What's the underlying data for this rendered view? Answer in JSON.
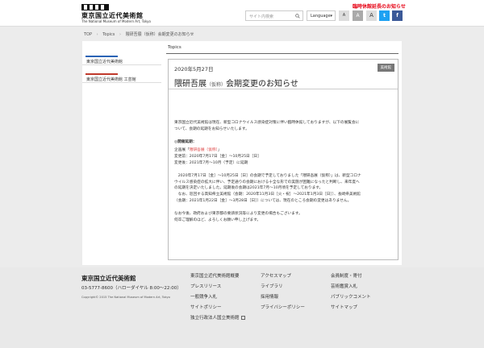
{
  "header": {
    "logo_jp": "東京国立近代美術館",
    "logo_en": "The National Museum of Modern Art, Tokyo",
    "search_placeholder": "サイト内検索",
    "language_label": "Language",
    "notice": "臨時休館延長のお知らせ",
    "font_small": "A",
    "font_mid": "A",
    "font_large": "A",
    "twitter": "t",
    "facebook": "f"
  },
  "breadcrumb": {
    "items": [
      "TOP",
      "Topics",
      "隈研吾展（仮称）会期変更のお知らせ"
    ]
  },
  "sidebar": {
    "items": [
      {
        "label": "東京国立近代美術館",
        "color": "#2a63b5"
      },
      {
        "label": "東京国立近代美術館 工芸館",
        "color": "#c0392b"
      }
    ]
  },
  "content": {
    "tab": "Topics",
    "date": "2020年5月27日",
    "category": "美術館",
    "title_main": "隈研吾展",
    "title_small": "（仮称）",
    "title_rest": "会期変更のお知らせ",
    "intro_1": "東京国立近代美術館は現在、新型コロナウイルス感染症対策に伴い臨時休館しておりますが、以下の展覧会に",
    "intro_2": "ついて、会期の延期をお知らせいたします。",
    "heading": "◎開催延期：",
    "plan_prefix": "企画展「",
    "plan_link": "隈研吾展（仮称）",
    "plan_suffix": "」",
    "before": "変更前：2020年7月17日［金］〜10月25日［日］",
    "after": "変更後：2021年7月〜10月（予定）に延期",
    "para_1": "　2020年7月17日［金］〜10月25日［日］の会期で予定しておりました「隈研吾展（仮称）」は、新型コロナ",
    "para_2": "ウイルス感染症の拡大に伴い、予定通りの会期における十全な形での実施が困難になったと判断し、来年度へ",
    "para_3": "の延期を決定いたしました。延期後の会期は2021年7月〜10月頃を予定しております。",
    "para_4": "　なお、巡回する高知県立美術館（会期：2020年11月3日［火・祝］〜2021年1月3日［日］）、長崎県美術館",
    "para_5": "（会期：2021年1月22日［金］〜3月28日［日］）については、現在のところ会期の変更はありません。",
    "closing_1": "なお今後、政府および東京都の要請状況等により変更の場合もございます。",
    "closing_2": "何卒ご理解のほど、よろしくお願い申し上げます。"
  },
  "footer": {
    "name": "東京国立近代美術館",
    "tel": "03-5777-8600（ハローダイヤル 8:00〜22:00）",
    "copyright": "Copyright© 2015 The National Museum of Modern Art, Tokyo",
    "col1": [
      "東京国立近代美術館概要",
      "プレスリリース",
      "一般競争入札",
      "サイトポリシー",
      "独立行政法人国立美術館"
    ],
    "col2": [
      "アクセスマップ",
      "ライブラリ",
      "採用情報",
      "プライバシーポリシー"
    ],
    "col3": [
      "会員制度・寄付",
      "芸術鑑賞入札",
      "パブリックコメント",
      "サイトマップ"
    ]
  }
}
